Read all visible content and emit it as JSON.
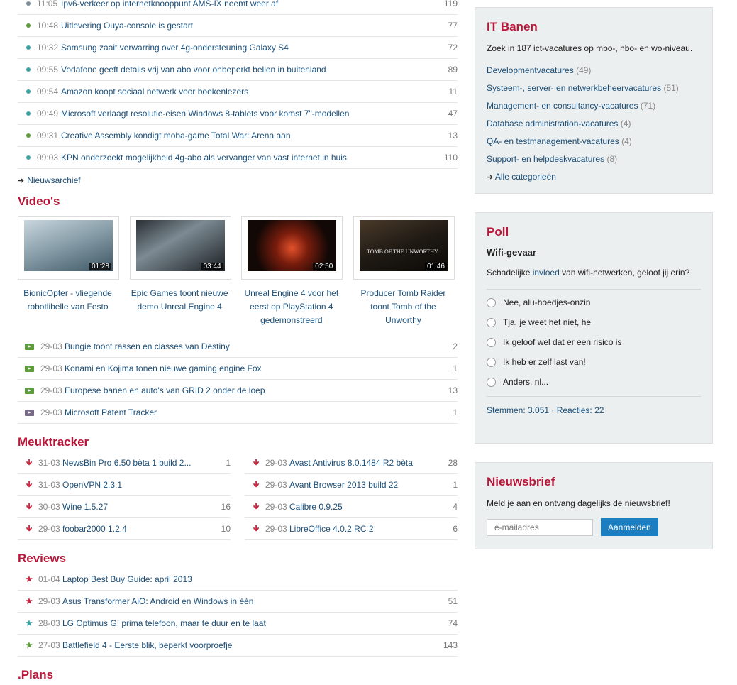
{
  "news": {
    "items": [
      {
        "time": "11:05",
        "title": "Ipv6-verkeer op internetknooppunt AMS-IX neemt weer af",
        "count": "119",
        "color": "#7a8f97"
      },
      {
        "time": "10:48",
        "title": "Uitlevering Ouya-console is gestart",
        "count": "77",
        "color": "#5c9d3a"
      },
      {
        "time": "10:32",
        "title": "Samsung zaait verwarring over 4g-ondersteuning Galaxy S4",
        "count": "72",
        "color": "#3aa3a3"
      },
      {
        "time": "09:55",
        "title": "Vodafone geeft details vrij van abo voor onbeperkt bellen in buitenland",
        "count": "89",
        "color": "#3aa3a3"
      },
      {
        "time": "09:54",
        "title": "Amazon koopt sociaal netwerk voor boekenlezers",
        "count": "11",
        "color": "#3aa3a3"
      },
      {
        "time": "09:49",
        "title": "Microsoft verlaagt resolutie-eisen Windows 8-tablets voor komst 7\"-modellen",
        "count": "47",
        "color": "#3aa3a3"
      },
      {
        "time": "09:31",
        "title": "Creative Assembly kondigt moba-game Total War: Arena aan",
        "count": "13",
        "color": "#5c9d3a"
      },
      {
        "time": "09:03",
        "title": "KPN onderzoekt mogelijkheid 4g-abo als vervanger van vast internet in huis",
        "count": "110",
        "color": "#3aa3a3"
      }
    ],
    "archive_label": "Nieuwsarchief"
  },
  "videos": {
    "heading": "Video's",
    "thumbs": [
      {
        "duration": "01:28",
        "title": "BionicOpter - vliegende robotlibelle van Festo",
        "brand": ""
      },
      {
        "duration": "03:44",
        "title": "Epic Games toont nieuwe demo Unreal Engine 4",
        "brand": ""
      },
      {
        "duration": "02:50",
        "title": "Unreal Engine 4 voor het eerst op PlayStation 4 gedemonstreerd",
        "brand": ""
      },
      {
        "duration": "01:46",
        "title": "Producer Tomb Raider toont Tomb of the Unworthy",
        "brand": "TOMB OF THE UNWORTHY"
      }
    ],
    "list": [
      {
        "date": "29-03",
        "title": "Bungie toont rassen en classes van Destiny",
        "count": "2",
        "color": "#5c9d3a"
      },
      {
        "date": "29-03",
        "title": "Konami en Kojima tonen nieuwe gaming engine Fox",
        "count": "1",
        "color": "#5c9d3a"
      },
      {
        "date": "29-03",
        "title": "Europese banen en auto's van GRID 2 onder de loep",
        "count": "13",
        "color": "#5c9d3a"
      },
      {
        "date": "29-03",
        "title": "Microsoft Patent Tracker",
        "count": "1",
        "color": "#7a6a8a"
      }
    ]
  },
  "meuktracker": {
    "heading": "Meuktracker",
    "left": [
      {
        "date": "31-03",
        "title": "NewsBin Pro 6.50 bèta 1 build 2...",
        "count": "1"
      },
      {
        "date": "31-03",
        "title": "OpenVPN 2.3.1",
        "count": ""
      },
      {
        "date": "30-03",
        "title": "Wine 1.5.27",
        "count": "16"
      },
      {
        "date": "29-03",
        "title": "foobar2000 1.2.4",
        "count": "10"
      }
    ],
    "right": [
      {
        "date": "29-03",
        "title": "Avast Antivirus 8.0.1484 R2 bèta",
        "count": "28"
      },
      {
        "date": "29-03",
        "title": "Avant Browser 2013 build 22",
        "count": "1"
      },
      {
        "date": "29-03",
        "title": "Calibre 0.9.25",
        "count": "4"
      },
      {
        "date": "29-03",
        "title": "LibreOffice 4.0.2 RC 2",
        "count": "6"
      }
    ]
  },
  "reviews": {
    "heading": "Reviews",
    "items": [
      {
        "date": "01-04",
        "title": "Laptop Best Buy Guide: april 2013",
        "count": "",
        "color": "#c9243f"
      },
      {
        "date": "29-03",
        "title": "Asus Transformer AiO: Android en Windows in één",
        "count": "51",
        "color": "#c9243f"
      },
      {
        "date": "28-03",
        "title": "LG Optimus G: prima telefoon, maar te duur en te laat",
        "count": "74",
        "color": "#3aa3a3"
      },
      {
        "date": "27-03",
        "title": "Battlefield 4 - Eerste blik, beperkt voorproefje",
        "count": "143",
        "color": "#5c9d3a"
      }
    ]
  },
  "plans": {
    "heading": ".Plans"
  },
  "itbanen": {
    "heading": "IT Banen",
    "intro": "Zoek in 187 ict-vacatures op mbo-, hbo- en wo-niveau.",
    "categories": [
      {
        "label": "Developmentvacatures",
        "count": "(49)"
      },
      {
        "label": "Systeem-, server- en netwerkbeheervacatures",
        "count": "(51)"
      },
      {
        "label": "Management- en consultancy-vacatures",
        "count": "(71)"
      },
      {
        "label": "Database administration-vacatures",
        "count": "(4)"
      },
      {
        "label": "QA- en testmanagement-vacatures",
        "count": "(4)"
      },
      {
        "label": "Support- en helpdeskvacatures",
        "count": "(8)"
      }
    ],
    "all_label": "Alle categorieën"
  },
  "poll": {
    "heading": "Poll",
    "question": "Wifi-gevaar",
    "desc_before": "Schadelijke ",
    "desc_link": "invloed",
    "desc_after": " van wifi-netwerken, geloof jij erin?",
    "options": [
      "Nee, alu-hoedjes-onzin",
      "Tja, je weet het niet, he",
      "Ik geloof wel dat er een risico is",
      "Ik heb er zelf last van!",
      "Anders, nl..."
    ],
    "stats": "Stemmen: 3.051 · Reacties: 22"
  },
  "newsletter": {
    "heading": "Nieuwsbrief",
    "text": "Meld je aan en ontvang dagelijks de nieuwsbrief!",
    "placeholder": "e-mailadres",
    "button": "Aanmelden"
  }
}
